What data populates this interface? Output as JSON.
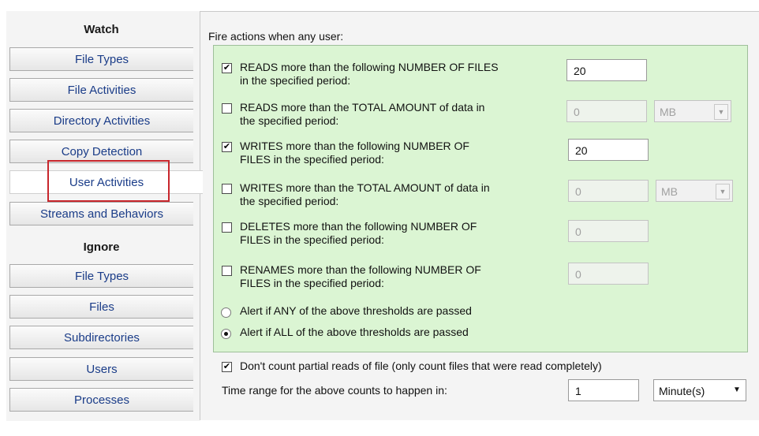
{
  "sidebar": {
    "watch_header": "Watch",
    "watch_items": [
      {
        "label": "File Types"
      },
      {
        "label": "File Activities"
      },
      {
        "label": "Directory Activities"
      },
      {
        "label": "Copy Detection"
      },
      {
        "label": "User Activities",
        "active": true
      },
      {
        "label": "Streams and Behaviors"
      }
    ],
    "ignore_header": "Ignore",
    "ignore_items": [
      {
        "label": "File Types"
      },
      {
        "label": "Files"
      },
      {
        "label": "Subdirectories"
      },
      {
        "label": "Users"
      },
      {
        "label": "Processes"
      }
    ]
  },
  "main": {
    "fire_label": "Fire actions when any user:",
    "thresholds": [
      {
        "line1": "READS more than the following NUMBER OF FILES",
        "line2": "in the specified period:",
        "checked": true,
        "value": "20",
        "enabled": true
      },
      {
        "line1": "READS more than the TOTAL AMOUNT of data in",
        "line2": "the specified period:",
        "checked": false,
        "value": "0",
        "enabled": false,
        "unit": "MB"
      },
      {
        "line1": "WRITES more than the following NUMBER OF",
        "line2": "FILES in the specified period:",
        "checked": true,
        "value": "20",
        "enabled": true
      },
      {
        "line1": "WRITES more than the TOTAL AMOUNT of data in",
        "line2": "the specified period:",
        "checked": false,
        "value": "0",
        "enabled": false,
        "unit": "MB"
      },
      {
        "line1": "DELETES more than the following NUMBER OF",
        "line2": "FILES in the specified period:",
        "checked": false,
        "value": "0",
        "enabled": false
      },
      {
        "line1": "RENAMES more than the following NUMBER OF",
        "line2": "FILES in the specified period:",
        "checked": false,
        "value": "0",
        "enabled": false
      }
    ],
    "alert_any": "Alert if ANY of the above thresholds are passed",
    "alert_all": "Alert if ALL of the above thresholds are passed",
    "alert_selected": "all",
    "partial_reads": {
      "label": "Don't count partial reads of file (only count files that were read completely)",
      "checked": true
    },
    "time_range": {
      "label": "Time range for the above counts to happen in:",
      "value": "1",
      "unit": "Minute(s)"
    }
  },
  "icons": {
    "checkmark": "checkmark-icon",
    "dropdown": "dropdown-arrow-icon"
  },
  "colors": {
    "green_panel": "#dbf5d3",
    "nav_text": "#1a3c88",
    "highlight": "#c8262c"
  }
}
